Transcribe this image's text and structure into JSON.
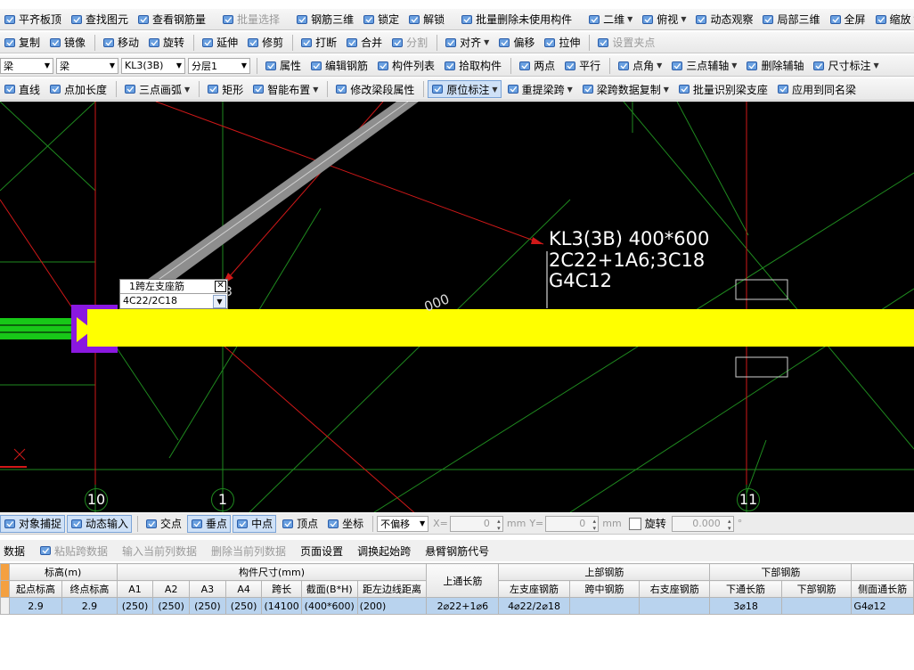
{
  "toolbar1": {
    "items": [
      {
        "label": "平齐板顶",
        "icon": "align-top-icon"
      },
      {
        "label": "查找图元",
        "icon": "binoculars-icon"
      },
      {
        "label": "查看钢筋量",
        "icon": "rebar-quantity-icon"
      },
      {
        "label": "批量选择",
        "icon": "batch-select-icon",
        "disabled": true
      },
      {
        "label": "钢筋三维",
        "icon": "rebar-3d-icon"
      },
      {
        "label": "锁定",
        "icon": "lock-icon"
      },
      {
        "label": "解锁",
        "icon": "unlock-icon"
      },
      {
        "label": "批量删除未使用构件",
        "icon": "batch-delete-icon"
      },
      {
        "label": "二维",
        "icon": "2d-view-icon",
        "dropdown": true
      },
      {
        "label": "俯视",
        "icon": "top-view-icon",
        "dropdown": true
      },
      {
        "label": "动态观察",
        "icon": "orbit-icon"
      },
      {
        "label": "局部三维",
        "icon": "local-3d-icon"
      },
      {
        "label": "全屏",
        "icon": "fullscreen-icon"
      },
      {
        "label": "缩放",
        "icon": "zoom-icon",
        "dropdown": true
      }
    ]
  },
  "toolbar2": {
    "items": [
      {
        "label": "复制",
        "icon": "copy-icon"
      },
      {
        "label": "镜像",
        "icon": "mirror-icon"
      },
      {
        "label": "移动",
        "icon": "move-icon"
      },
      {
        "label": "旋转",
        "icon": "rotate-icon"
      },
      {
        "label": "延伸",
        "icon": "extend-icon"
      },
      {
        "label": "修剪",
        "icon": "trim-icon"
      },
      {
        "label": "打断",
        "icon": "break-icon"
      },
      {
        "label": "合并",
        "icon": "merge-icon"
      },
      {
        "label": "分割",
        "icon": "split-icon",
        "disabled": true
      },
      {
        "label": "对齐",
        "icon": "align-icon",
        "dropdown": true
      },
      {
        "label": "偏移",
        "icon": "offset-icon"
      },
      {
        "label": "拉伸",
        "icon": "stretch-icon"
      },
      {
        "label": "设置夹点",
        "icon": "grip-icon",
        "disabled": true
      }
    ]
  },
  "toolbar3": {
    "combo_category": "梁",
    "combo_type": "梁",
    "combo_element": "KL3(3B)",
    "combo_layer": "分层1",
    "items": [
      {
        "label": "属性",
        "icon": "properties-icon"
      },
      {
        "label": "编辑钢筋",
        "icon": "edit-rebar-icon"
      },
      {
        "label": "构件列表",
        "icon": "component-list-icon"
      },
      {
        "label": "拾取构件",
        "icon": "pick-component-icon"
      },
      {
        "label": "两点",
        "icon": "two-point-icon"
      },
      {
        "label": "平行",
        "icon": "parallel-icon"
      },
      {
        "label": "点角",
        "icon": "point-angle-icon",
        "dropdown": true
      },
      {
        "label": "三点辅轴",
        "icon": "three-point-axis-icon",
        "dropdown": true
      },
      {
        "label": "删除辅轴",
        "icon": "delete-axis-icon"
      },
      {
        "label": "尺寸标注",
        "icon": "dimension-icon",
        "dropdown": true
      }
    ]
  },
  "toolbar4": {
    "items": [
      {
        "label": "直线",
        "icon": "line-icon"
      },
      {
        "label": "点加长度",
        "icon": "point-length-icon"
      },
      {
        "label": "三点画弧",
        "icon": "arc-icon",
        "dropdown": true
      },
      {
        "label": "矩形",
        "icon": "rectangle-icon"
      },
      {
        "label": "智能布置",
        "icon": "smart-layout-icon",
        "dropdown": true
      },
      {
        "label": "修改梁段属性",
        "icon": "modify-segment-icon"
      },
      {
        "label": "原位标注",
        "icon": "in-situ-annotation-icon",
        "pressed": true,
        "dropdown": true
      },
      {
        "label": "重提梁跨",
        "icon": "re-extract-span-icon",
        "dropdown": true
      },
      {
        "label": "梁跨数据复制",
        "icon": "span-copy-icon",
        "dropdown": true
      },
      {
        "label": "批量识别梁支座",
        "icon": "batch-support-icon"
      },
      {
        "label": "应用到同名梁",
        "icon": "apply-same-name-icon"
      }
    ]
  },
  "canvas": {
    "annotation": [
      "KL3(3B) 400*600",
      "2C22+1A6;3C18",
      "G4C12"
    ],
    "dim_text": "000",
    "axis_labels": [
      "10",
      "1",
      "11"
    ],
    "popup_title": "1跨左支座筋",
    "popup_value": "4C22/2C18",
    "stub_text": "3"
  },
  "snapbar": {
    "items": [
      {
        "label": "对象捕捉",
        "icon": "object-snap-icon",
        "pressed": true
      },
      {
        "label": "动态输入",
        "icon": "dynamic-input-icon",
        "pressed": true
      },
      {
        "label": "交点",
        "icon": "intersection-icon"
      },
      {
        "label": "垂点",
        "icon": "perpendicular-icon",
        "pressed": true
      },
      {
        "label": "中点",
        "icon": "midpoint-icon",
        "pressed": true
      },
      {
        "label": "顶点",
        "icon": "vertex-icon"
      },
      {
        "label": "坐标",
        "icon": "coordinate-icon"
      }
    ],
    "offset_combo": "不偏移",
    "x_label": "X=",
    "x_value": "0",
    "y_label": "Y=",
    "y_value": "0",
    "unit": "mm",
    "rotate_label": "旋转",
    "rotate_value": "0.000",
    "degree": "°"
  },
  "gridbar": {
    "items": [
      {
        "label": "数据"
      },
      {
        "label": "粘贴跨数据",
        "icon": "paste-icon",
        "disabled": true
      },
      {
        "label": "输入当前列数据",
        "disabled": true
      },
      {
        "label": "删除当前列数据",
        "disabled": true
      },
      {
        "label": "页面设置"
      },
      {
        "label": "调换起始跨"
      },
      {
        "label": "悬臂钢筋代号"
      }
    ]
  },
  "table": {
    "group_headers": {
      "elevation": "标高(m)",
      "size": "构件尺寸(mm)",
      "top_through": "上通长筋",
      "top_rebar": "上部钢筋",
      "bottom_rebar": "下部钢筋"
    },
    "columns": [
      "起点标高",
      "终点标高",
      "A1",
      "A2",
      "A3",
      "A4",
      "跨长",
      "截面(B*H)",
      "距左边线距离",
      "上通长筋",
      "左支座钢筋",
      "跨中钢筋",
      "右支座钢筋",
      "下通长筋",
      "下部钢筋",
      "侧面通长筋"
    ],
    "rows": [
      [
        "2.9",
        "2.9",
        "(250)",
        "(250)",
        "(250)",
        "(250)",
        "(14100",
        "(400*600)",
        "(200)",
        "2⌀22+1⌀6",
        "4⌀22/2⌀18",
        "",
        "",
        "3⌀18",
        "",
        "G4⌀12"
      ]
    ]
  }
}
